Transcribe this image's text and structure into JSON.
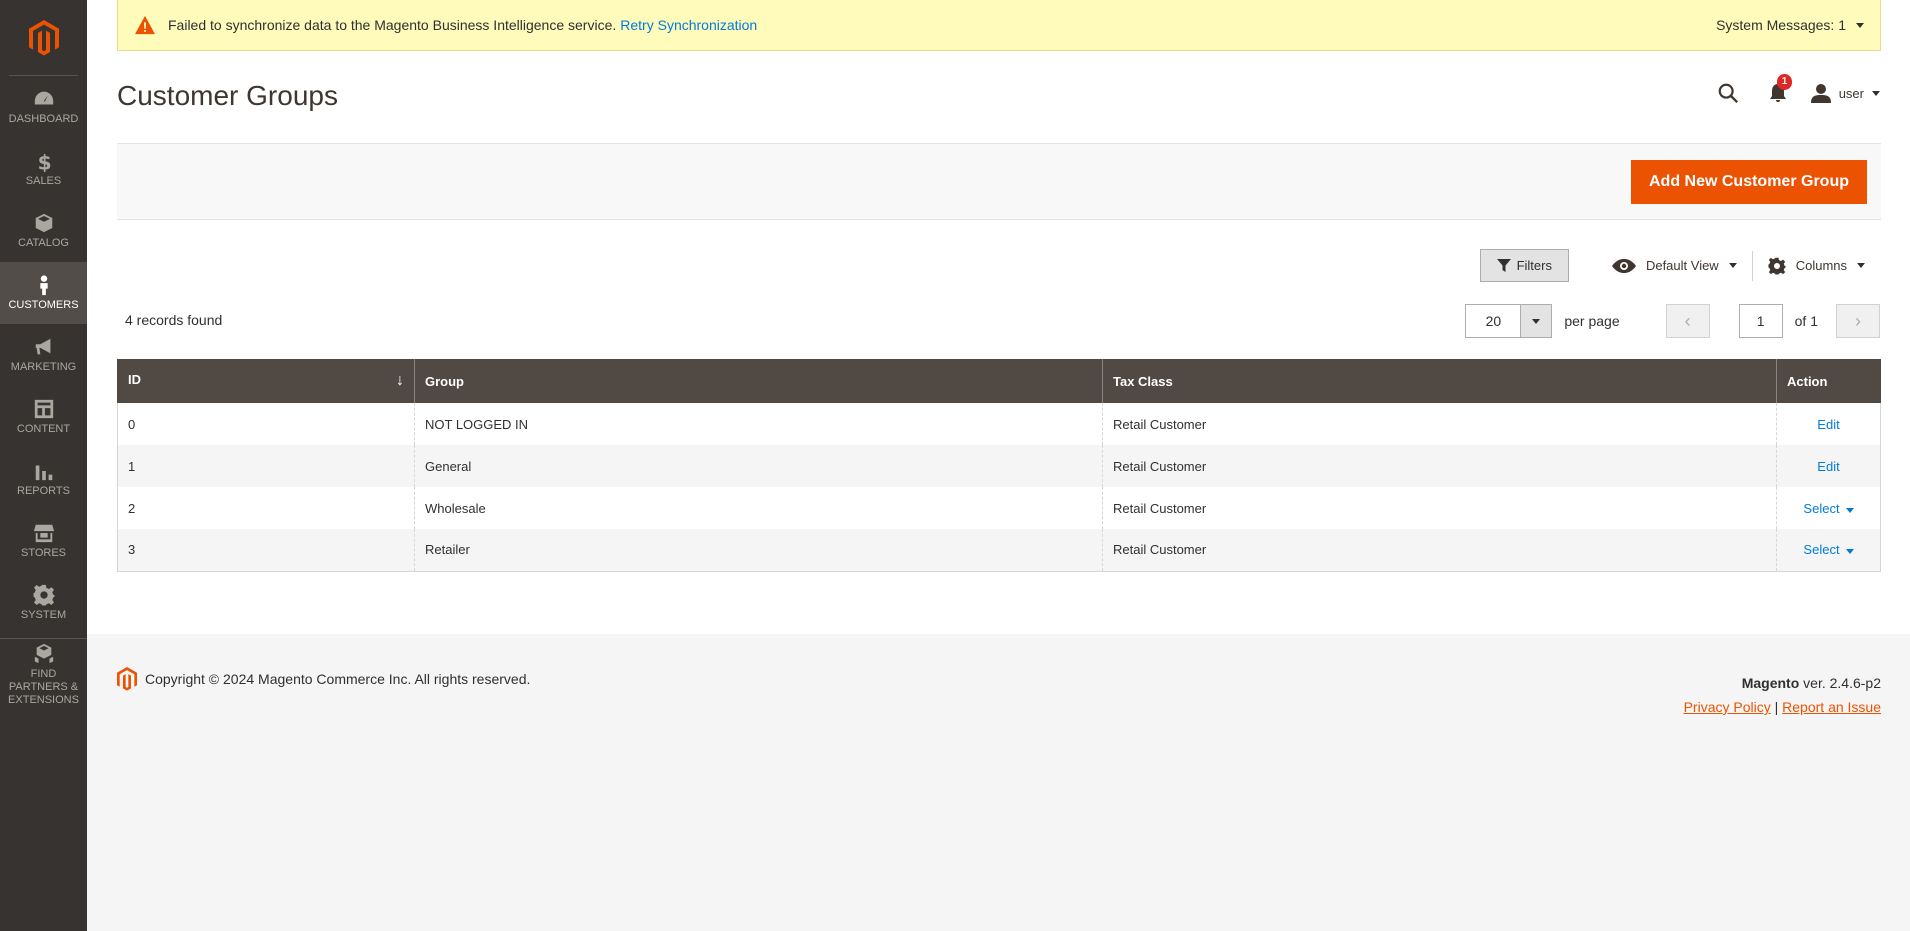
{
  "sidebar": {
    "items": [
      {
        "label": "DASHBOARD",
        "icon": "dashboard-icon"
      },
      {
        "label": "SALES",
        "icon": "dollar-icon"
      },
      {
        "label": "CATALOG",
        "icon": "cube-icon"
      },
      {
        "label": "CUSTOMERS",
        "icon": "person-icon"
      },
      {
        "label": "MARKETING",
        "icon": "megaphone-icon"
      },
      {
        "label": "CONTENT",
        "icon": "layout-icon"
      },
      {
        "label": "REPORTS",
        "icon": "bar-chart-icon"
      },
      {
        "label": "STORES",
        "icon": "storefront-icon"
      },
      {
        "label": "SYSTEM",
        "icon": "gear-icon"
      },
      {
        "label": "FIND PARTNERS & EXTENSIONS",
        "icon": "boxes-icon"
      }
    ],
    "active": "CUSTOMERS"
  },
  "system_message": {
    "text": "Failed to synchronize data to the Magento Business Intelligence service.",
    "link": "Retry Synchronization",
    "counter": "System Messages: 1"
  },
  "header": {
    "title": "Customer Groups",
    "notifications_count": "1",
    "user": "user"
  },
  "actions": {
    "add_button": "Add New Customer Group"
  },
  "toolbar": {
    "filters": "Filters",
    "view": "Default View",
    "columns": "Columns"
  },
  "grid": {
    "records_found": "4 records found",
    "per_page_value": "20",
    "per_page_label": "per page",
    "current_page": "1",
    "of_pages": "of 1",
    "columns": [
      "ID",
      "Group",
      "Tax Class",
      "Action"
    ],
    "rows": [
      {
        "id": "0",
        "group": "NOT LOGGED IN",
        "tax_class": "Retail Customer",
        "action": "Edit"
      },
      {
        "id": "1",
        "group": "General",
        "tax_class": "Retail Customer",
        "action": "Edit"
      },
      {
        "id": "2",
        "group": "Wholesale",
        "tax_class": "Retail Customer",
        "action": "Select"
      },
      {
        "id": "3",
        "group": "Retailer",
        "tax_class": "Retail Customer",
        "action": "Select"
      }
    ]
  },
  "footer": {
    "copyright": "Copyright © 2024 Magento Commerce Inc. All rights reserved.",
    "brand": "Magento",
    "version": " ver. 2.4.6-p2",
    "privacy": "Privacy Policy",
    "separator": "|",
    "report": "Report an Issue"
  },
  "colors": {
    "accent": "#eb5202",
    "sidebar": "#373330",
    "table_header": "#514943",
    "link": "#007bdb"
  }
}
